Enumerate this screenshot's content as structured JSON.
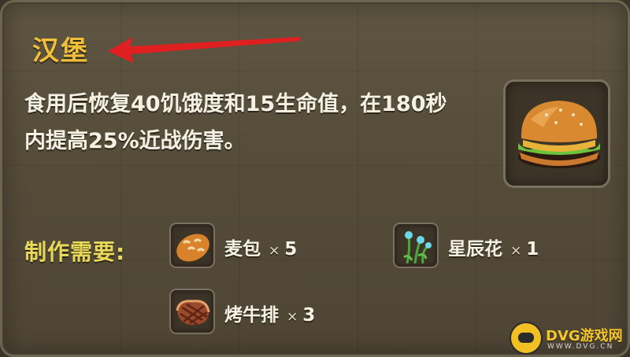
{
  "item": {
    "name": "汉堡",
    "description_line1": "食用后恢复40饥饿度和15生命值，在180秒",
    "description_line2": "内提高25%近战伤害。",
    "icon": "hamburger-icon"
  },
  "recipe": {
    "label": "制作需要:",
    "ingredients": [
      {
        "name": "麦包",
        "mult": "×",
        "qty": "5",
        "icon": "bread-icon"
      },
      {
        "name": "星辰花",
        "mult": "×",
        "qty": "1",
        "icon": "star-flower-icon"
      },
      {
        "name": "烤牛排",
        "mult": "×",
        "qty": "3",
        "icon": "steak-icon"
      }
    ]
  },
  "watermark": {
    "text": "DVG游戏网",
    "sub": "WWW.DVG.CN"
  },
  "colors": {
    "title": "#f2bf3b",
    "label": "#e8d95a",
    "arrow": "#e02020",
    "panel": "#564d3b"
  }
}
